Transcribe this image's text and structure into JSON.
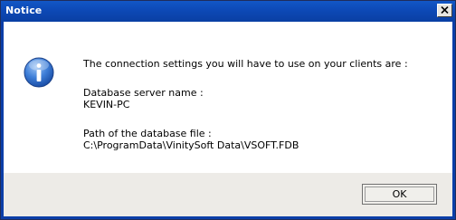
{
  "window": {
    "title": "Notice"
  },
  "icons": {
    "message": "info-icon",
    "close": "close-icon"
  },
  "message": {
    "line1": "The connection settings you will have to use on your clients are :",
    "server_label": "Database server name :",
    "server_value": "KEVIN-PC",
    "path_label": "Path of the database file :",
    "path_value": "C:\\ProgramData\\VinitySoft Data\\VSOFT.FDB"
  },
  "buttons": {
    "ok_label": "OK"
  },
  "colors": {
    "titlebar": "#0d49b6",
    "button_area": "#edebe7"
  }
}
